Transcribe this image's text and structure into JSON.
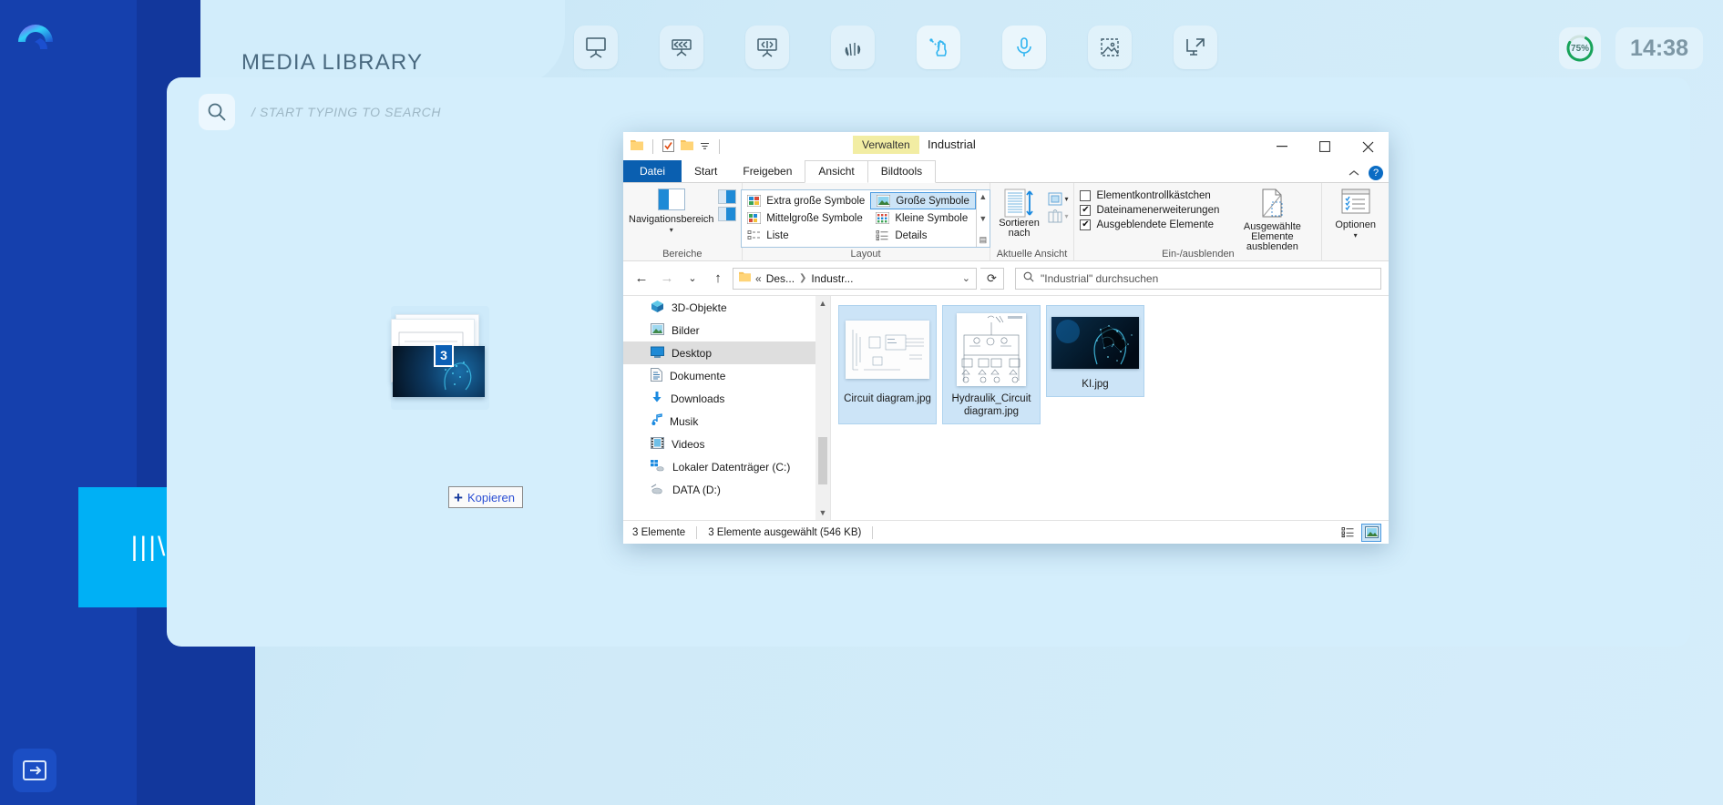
{
  "app": {
    "title": "MEDIA LIBRARY",
    "logo_icon": "app-logo-arc",
    "search": {
      "placeholder": "/ START TYPING TO SEARCH",
      "icon": "search-icon"
    },
    "rail": {
      "items": [
        {
          "icon": "video-camera-icon",
          "name": "video"
        },
        {
          "icon": "whiteboard-chart-icon",
          "name": "whiteboard"
        },
        {
          "icon": "media-library-icon",
          "name": "media-library",
          "label": "|||\\",
          "active": true
        }
      ],
      "logout_icon": "logout-arrow-icon"
    },
    "toolbar": [
      {
        "icon": "presentation-board-icon",
        "name": "board"
      },
      {
        "icon": "annotation-arrows-icon",
        "name": "annotate"
      },
      {
        "icon": "resize-board-icon",
        "name": "resize"
      },
      {
        "icon": "hand-gesture-icon",
        "name": "gesture"
      },
      {
        "icon": "touch-pointer-icon",
        "name": "pointer",
        "accent": true
      },
      {
        "icon": "microphone-icon",
        "name": "microphone",
        "accent": true
      },
      {
        "icon": "image-crop-icon",
        "name": "image-crop"
      },
      {
        "icon": "screen-share-icon",
        "name": "screen-share"
      }
    ],
    "status": {
      "battery": "75%",
      "clock": "14:38"
    },
    "accent_color": "#00b0f5",
    "rail_color": "#1540ad"
  },
  "drag": {
    "badge_count": "3",
    "tooltip": "Kopieren",
    "tooltip_icon": "plus-icon"
  },
  "explorer": {
    "window_title": "Industrial",
    "context_tab": "Verwalten",
    "quick_access": [
      {
        "icon": "folder-icon",
        "name": "qat-folder"
      },
      {
        "icon": "properties-checkbox-icon",
        "name": "qat-properties"
      },
      {
        "icon": "new-folder-icon",
        "name": "qat-new-folder"
      },
      {
        "icon": "chevron-down-icon",
        "name": "qat-customize"
      }
    ],
    "window_controls": [
      {
        "icon": "minimize-icon",
        "name": "minimize",
        "glyph": "─"
      },
      {
        "icon": "maximize-icon",
        "name": "maximize",
        "glyph": "□"
      },
      {
        "icon": "close-icon",
        "name": "close",
        "glyph": "✕"
      }
    ],
    "tabs": [
      {
        "label": "Datei",
        "type": "file"
      },
      {
        "label": "Start",
        "type": "normal"
      },
      {
        "label": "Freigeben",
        "type": "normal"
      },
      {
        "label": "Ansicht",
        "type": "active"
      },
      {
        "label": "Bildtools",
        "type": "sub"
      }
    ],
    "ribbon_collapse_icon": "chevron-up-icon",
    "help_icon": "help-icon",
    "groups": {
      "panes": {
        "label": "Bereiche",
        "nav_button": "Navigationsbereich",
        "buttons": [
          {
            "name": "preview-pane",
            "icon": "preview-pane-icon"
          },
          {
            "name": "details-pane",
            "icon": "details-pane-icon"
          }
        ]
      },
      "layout": {
        "label": "Layout",
        "items": [
          {
            "label": "Extra große Symbole",
            "selected": false,
            "icon": "extra-large-icons-icon"
          },
          {
            "label": "Mittelgroße Symbole",
            "selected": false,
            "icon": "medium-icons-icon"
          },
          {
            "label": "Liste",
            "selected": false,
            "icon": "list-view-icon"
          },
          {
            "label": "Große Symbole",
            "selected": true,
            "icon": "large-icons-icon"
          },
          {
            "label": "Kleine Symbole",
            "selected": false,
            "icon": "small-icons-icon"
          },
          {
            "label": "Details",
            "selected": false,
            "icon": "details-view-icon"
          }
        ]
      },
      "current_view": {
        "label": "Aktuelle Ansicht",
        "sort_button": "Sortieren nach",
        "buttons": [
          {
            "name": "add-columns",
            "icon": "columns-icon"
          },
          {
            "name": "size-all-columns",
            "icon": "fit-columns-icon"
          }
        ]
      },
      "show_hide": {
        "label": "Ein-/ausblenden",
        "checkboxes": [
          {
            "label": "Elementkontrollkästchen",
            "checked": false
          },
          {
            "label": "Dateinamenerweiterungen",
            "checked": true
          },
          {
            "label": "Ausgeblendete Elemente",
            "checked": true
          }
        ],
        "hide_button": "Ausgewählte Elemente ausblenden",
        "hide_button_icon": "hide-items-icon"
      },
      "options": {
        "label": "Optionen",
        "icon": "options-icon"
      }
    },
    "address": {
      "back_icon": "arrow-left-icon",
      "forward_icon": "arrow-right-icon",
      "recent_icon": "chevron-down-icon",
      "up_icon": "arrow-up-icon",
      "folder_icon": "folder-icon",
      "crumb_prefix": "«",
      "crumbs": [
        "Des...",
        "Industr..."
      ],
      "dropdown_icon": "chevron-down-icon",
      "refresh_icon": "refresh-icon",
      "search_placeholder": "\"Industrial\" durchsuchen",
      "search_icon": "search-icon"
    },
    "tree": [
      {
        "label": "3D-Objekte",
        "icon": "3d-objects-icon",
        "selected": false
      },
      {
        "label": "Bilder",
        "icon": "pictures-icon",
        "selected": false
      },
      {
        "label": "Desktop",
        "icon": "desktop-icon",
        "selected": true
      },
      {
        "label": "Dokumente",
        "icon": "documents-icon",
        "selected": false
      },
      {
        "label": "Downloads",
        "icon": "downloads-icon",
        "selected": false
      },
      {
        "label": "Musik",
        "icon": "music-icon",
        "selected": false
      },
      {
        "label": "Videos",
        "icon": "videos-icon",
        "selected": false
      },
      {
        "label": "Lokaler Datenträger (C:)",
        "icon": "hard-drive-icon",
        "selected": false
      },
      {
        "label": "DATA (D:)",
        "icon": "usb-drive-icon",
        "selected": false
      }
    ],
    "files": [
      {
        "name": "Circuit diagram.jpg",
        "thumb": "circuit-diagram-thumb",
        "selected": true
      },
      {
        "name": "Hydraulik_Circuit diagram.jpg",
        "thumb": "hydraulic-circuit-thumb",
        "selected": true
      },
      {
        "name": "KI.jpg",
        "thumb": "ai-head-thumb",
        "selected": true
      }
    ],
    "status": {
      "count": "3 Elemente",
      "selection": "3 Elemente ausgewählt (546 KB)",
      "view_buttons": [
        {
          "name": "details-view-toggle",
          "icon": "details-view-icon",
          "active": false
        },
        {
          "name": "large-icons-view-toggle",
          "icon": "large-icons-icon",
          "active": true
        }
      ]
    }
  }
}
